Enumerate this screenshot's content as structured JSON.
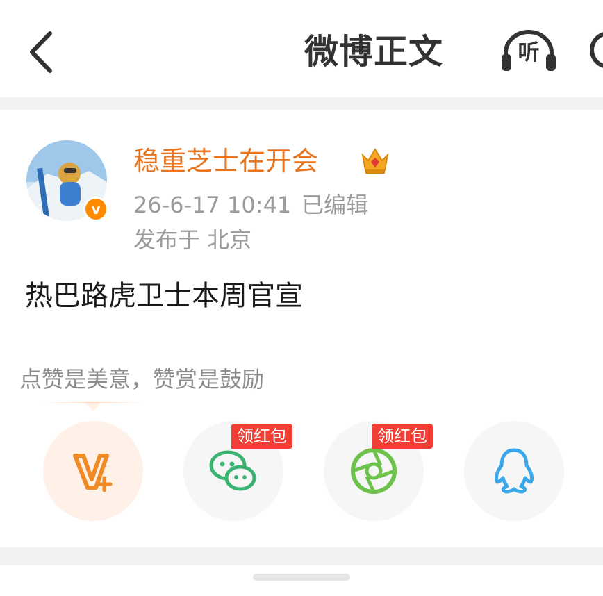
{
  "header": {
    "title": "微博正文",
    "listen_label": "听"
  },
  "post": {
    "author": "稳重芝士在开会",
    "time": "26-6-17 10:41",
    "edited": "已编辑",
    "location": "发布于 北京",
    "content": "热巴路虎卫士本周官宣"
  },
  "reward": {
    "hint": "点赞是美意，赞赏是鼓励"
  },
  "share": {
    "wechat_tag": "领红包",
    "moments_tag": "领红包"
  },
  "colors": {
    "accent_orange": "#e8741d",
    "wechat_green": "#3cb371",
    "moments_green": "#6cc24a",
    "qq_blue": "#3aa7e8",
    "tag_red": "#f23f35"
  }
}
